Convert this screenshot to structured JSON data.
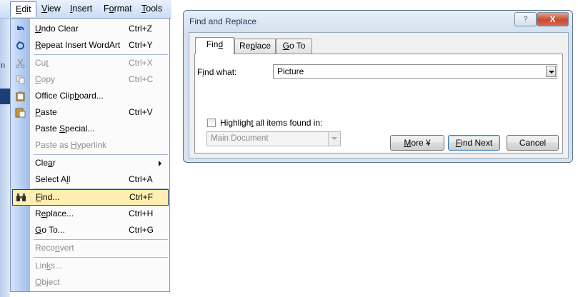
{
  "menubar": {
    "items": [
      {
        "label": "Edit",
        "ul": "E",
        "rest": "dit"
      },
      {
        "label": "View",
        "ul": "V",
        "rest": "iew"
      },
      {
        "label": "Insert",
        "ul": "I",
        "rest": "nsert"
      },
      {
        "label": "Format",
        "pre": "F",
        "ul": "o",
        "rest": "rmat"
      },
      {
        "label": "Tools",
        "ul": "T",
        "rest": "ools"
      }
    ],
    "edge_fragment": "n"
  },
  "edit_menu": {
    "items": [
      {
        "label": "Undo Clear",
        "pre": "",
        "ul": "U",
        "post": "ndo Clear",
        "shortcut": "Ctrl+Z",
        "icon": "undo-icon",
        "enabled": true
      },
      {
        "label": "Repeat Insert WordArt",
        "pre": "",
        "ul": "R",
        "post": "epeat Insert WordArt",
        "shortcut": "Ctrl+Y",
        "icon": "repeat-icon",
        "enabled": true
      },
      {
        "label": "Cut",
        "pre": "Cu",
        "ul": "t",
        "post": "",
        "shortcut": "Ctrl+X",
        "icon": "scissors-icon",
        "enabled": false
      },
      {
        "label": "Copy",
        "pre": "",
        "ul": "C",
        "post": "opy",
        "shortcut": "Ctrl+C",
        "icon": "copy-icon",
        "enabled": false
      },
      {
        "label": "Office Clipboard...",
        "pre": "Office Clip",
        "ul": "b",
        "post": "oard...",
        "shortcut": "",
        "icon": "clipboard-icon",
        "enabled": true
      },
      {
        "label": "Paste",
        "pre": "",
        "ul": "P",
        "post": "aste",
        "shortcut": "Ctrl+V",
        "icon": "paste-icon",
        "enabled": true
      },
      {
        "label": "Paste Special...",
        "pre": "Paste ",
        "ul": "S",
        "post": "pecial...",
        "shortcut": "",
        "icon": "",
        "enabled": true
      },
      {
        "label": "Paste as Hyperlink",
        "pre": "Paste as ",
        "ul": "H",
        "post": "yperlink",
        "shortcut": "",
        "icon": "",
        "enabled": false
      },
      {
        "label": "Clear",
        "pre": "Cle",
        "ul": "a",
        "post": "r",
        "shortcut": "",
        "icon": "",
        "enabled": true,
        "submenu": true
      },
      {
        "label": "Select All",
        "pre": "Select A",
        "ul": "l",
        "post": "l",
        "shortcut": "Ctrl+A",
        "icon": "",
        "enabled": true
      },
      {
        "label": "Find...",
        "pre": "",
        "ul": "F",
        "post": "ind...",
        "shortcut": "Ctrl+F",
        "icon": "binoculars-icon",
        "enabled": true,
        "highlighted": true
      },
      {
        "label": "Replace...",
        "pre": "R",
        "ul": "e",
        "post": "place...",
        "shortcut": "Ctrl+H",
        "icon": "",
        "enabled": true
      },
      {
        "label": "Go To...",
        "pre": "",
        "ul": "G",
        "post": "o To...",
        "shortcut": "Ctrl+G",
        "icon": "",
        "enabled": true
      },
      {
        "label": "Reconvert",
        "pre": "Reco",
        "ul": "n",
        "post": "vert",
        "shortcut": "",
        "icon": "",
        "enabled": false
      },
      {
        "label": "Links...",
        "pre": "Lin",
        "ul": "k",
        "post": "s...",
        "shortcut": "",
        "icon": "",
        "enabled": false
      },
      {
        "label": "Object",
        "pre": "",
        "ul": "O",
        "post": "bject",
        "shortcut": "",
        "icon": "",
        "enabled": false
      }
    ]
  },
  "dialog": {
    "title": "Find and Replace",
    "help_glyph": "?",
    "close_glyph": "X",
    "tabs": [
      {
        "label": "Find",
        "pre": "Fin",
        "ul": "d",
        "post": "",
        "active": true
      },
      {
        "label": "Replace",
        "pre": "Re",
        "ul": "p",
        "post": "lace",
        "active": false
      },
      {
        "label": "Go To",
        "pre": "",
        "ul": "G",
        "post": "o To",
        "active": false
      }
    ],
    "find_what": {
      "pre": "F",
      "ul": "i",
      "post": "nd what:",
      "value": "Picture"
    },
    "highlight": {
      "pre": "Highligh",
      "ul": "t",
      "post": " all items found in:",
      "checked": false
    },
    "scope_select": {
      "value": "Main Document"
    },
    "buttons": {
      "more": {
        "pre": "",
        "ul": "M",
        "post": "ore",
        "glyph": "¥"
      },
      "find_next": {
        "pre": "",
        "ul": "F",
        "post": "ind Next"
      },
      "cancel": {
        "label": "Cancel"
      }
    }
  },
  "colors": {
    "menu_highlight": "#ffeeaf",
    "menu_border": "#7f96bd",
    "close_button": "#c64a32",
    "dialog_frame": "#d3e1ee"
  }
}
